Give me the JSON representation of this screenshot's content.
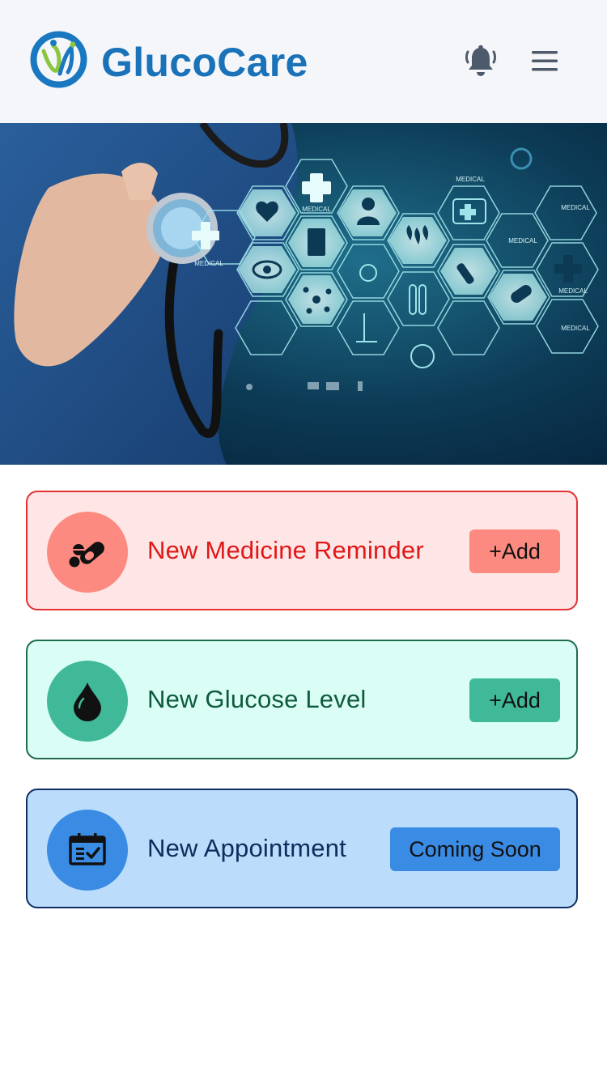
{
  "header": {
    "brand": "GlucoCare",
    "logo_icon": "glucocare-logo-icon",
    "notification_icon": "bell-icon",
    "menu_icon": "hamburger-menu-icon"
  },
  "hero": {
    "image": "doctor-with-stethoscope-medical-icons-banner",
    "labels": [
      "MEDICAL",
      "MEDICAL",
      "MEDICAL",
      "MEDICAL",
      "MEDICAL",
      "MEDICAL",
      "MEDICAL"
    ]
  },
  "actions": [
    {
      "icon": "pills-icon",
      "title": "New Medicine Reminder",
      "button": "+Add",
      "colors": {
        "background": "#ffe6e6",
        "border": "#e53030",
        "accent": "#fc8a80",
        "text": "#e01818"
      }
    },
    {
      "icon": "blood-drop-icon",
      "title": "New Glucose Level",
      "button": "+Add",
      "colors": {
        "background": "#dafef5",
        "border": "#1f6b4e",
        "accent": "#40b998",
        "text": "#0d5a3c"
      }
    },
    {
      "icon": "calendar-check-icon",
      "title": "New Appointment",
      "button": "Coming Soon",
      "colors": {
        "background": "#bcdcfc",
        "border": "#0f2f64",
        "accent": "#3a8be3",
        "text": "#0e2c5c"
      }
    }
  ]
}
